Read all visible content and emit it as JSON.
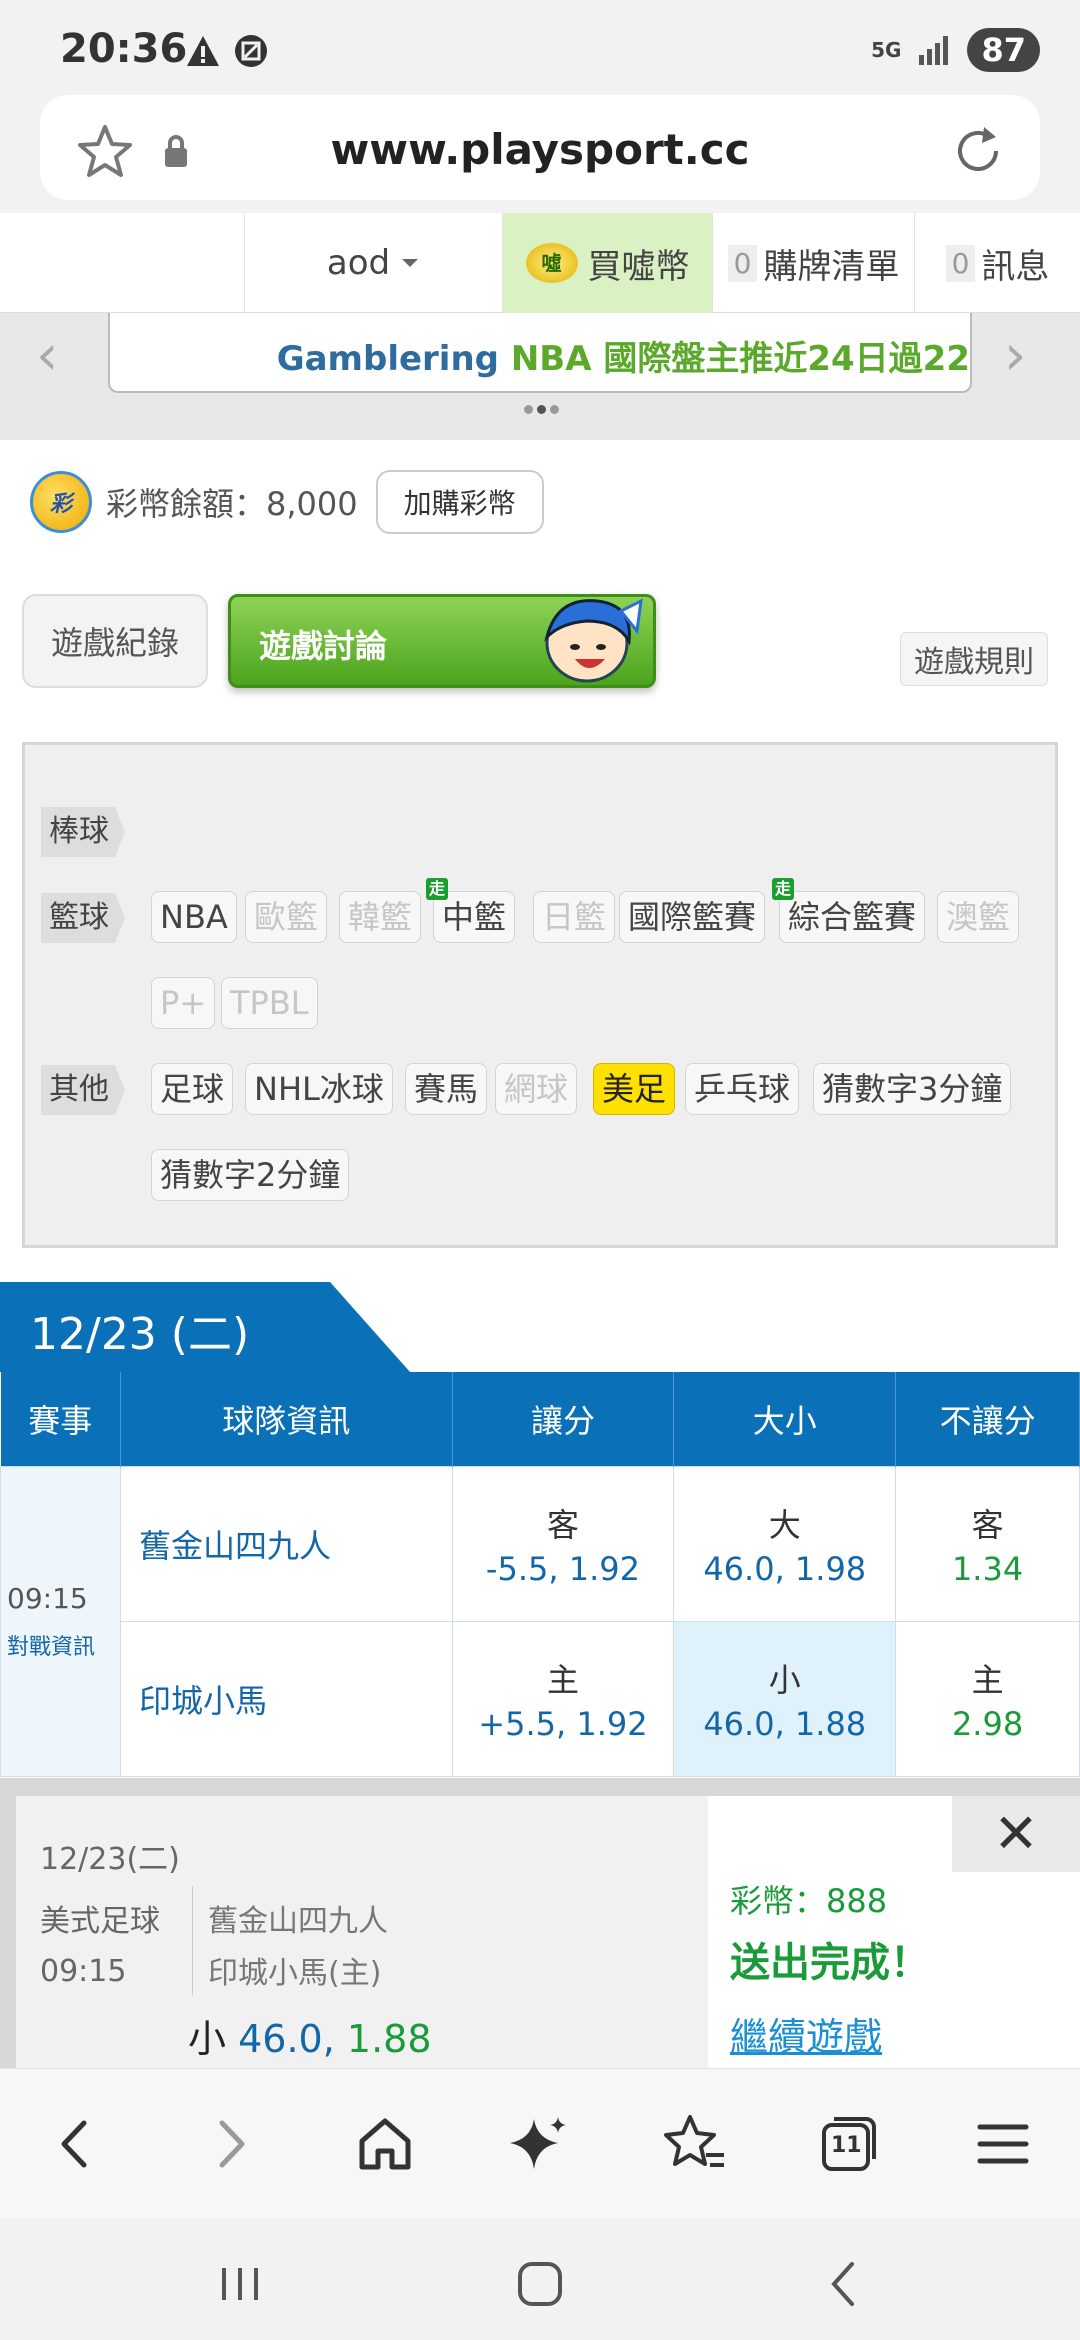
{
  "status": {
    "time": "20:36",
    "network": "5G",
    "battery": "87"
  },
  "browser": {
    "url": "www.playsport.cc",
    "tab_count": "11"
  },
  "nav": {
    "user": "aod",
    "buy_coin": "買噓幣",
    "buy_coin_badge": "噓",
    "cart_count": "0",
    "cart": "購牌清單",
    "msg_count": "0",
    "messages": "訊息"
  },
  "marquee": {
    "brand": "Gamblering",
    "text": " NBA 國際盤主推近24日過22"
  },
  "balance": {
    "coin_badge": "彩",
    "label": "彩幣餘額：8,000",
    "add_button": "加購彩幣"
  },
  "tabs": {
    "record": "遊戲紀錄",
    "discussion": "遊戲討論",
    "rules": "遊戲規則"
  },
  "categories": {
    "baseball": "棒球",
    "basketball": "籃球",
    "other": "其他",
    "walk_badge": "走",
    "basketball_items": [
      "NBA",
      "歐籃",
      "韓籃",
      "中籃",
      "日籃",
      "國際籃賽",
      "綜合籃賽",
      "澳籃",
      "P+",
      "TPBL"
    ],
    "other_items": [
      "足球",
      "NHL冰球",
      "賽馬",
      "網球",
      "美足",
      "乒乓球",
      "猜數字3分鐘",
      "猜數字2分鐘"
    ]
  },
  "schedule": {
    "date": "12/23 (二)",
    "headers": [
      "賽事",
      "球隊資訊",
      "讓分",
      "大小",
      "不讓分"
    ],
    "game": {
      "time": "09:15",
      "info_link": "對戰資訊",
      "away": {
        "team": "舊金山四九人",
        "spread_side": "客",
        "spread": "-5.5, 1.92",
        "total_side": "大",
        "total": "46.0, 1.98",
        "ml_side": "客",
        "ml": "1.34"
      },
      "home": {
        "team": "印城小馬",
        "spread_side": "主",
        "spread": "+5.5, 1.92",
        "total_side": "小",
        "total": "46.0, 1.88",
        "ml_side": "主",
        "ml": "2.98"
      }
    }
  },
  "slip": {
    "date": "12/23(二)",
    "sport": "美式足球",
    "time": "09:15",
    "team1": "舊金山四九人",
    "team2": "印城小馬(主)",
    "bet_side": "小",
    "bet_line": "46.0,",
    "bet_odds": "1.88",
    "close": "✕",
    "coins": "彩幣：888",
    "done": "送出完成！",
    "continue": "繼續遊戲"
  },
  "colors": {
    "primary_blue": "#0a70b8",
    "green": "#1b9a3a",
    "highlight_yellow": "#ffe000"
  }
}
